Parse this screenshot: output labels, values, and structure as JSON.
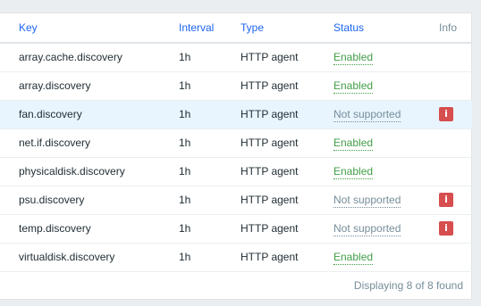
{
  "table": {
    "columns": [
      "Key",
      "Interval",
      "Type",
      "Status",
      "Info"
    ],
    "rows": [
      {
        "key": "array.cache.discovery",
        "interval": "1h",
        "type": "HTTP agent",
        "status": "Enabled",
        "info": false
      },
      {
        "key": "array.discovery",
        "interval": "1h",
        "type": "HTTP agent",
        "status": "Enabled",
        "info": false
      },
      {
        "key": "fan.discovery",
        "interval": "1h",
        "type": "HTTP agent",
        "status": "Not supported",
        "info": true,
        "highlighted": true
      },
      {
        "key": "net.if.discovery",
        "interval": "1h",
        "type": "HTTP agent",
        "status": "Enabled",
        "info": false
      },
      {
        "key": "physicaldisk.discovery",
        "interval": "1h",
        "type": "HTTP agent",
        "status": "Enabled",
        "info": false
      },
      {
        "key": "psu.discovery",
        "interval": "1h",
        "type": "HTTP agent",
        "status": "Not supported",
        "info": true
      },
      {
        "key": "temp.discovery",
        "interval": "1h",
        "type": "HTTP agent",
        "status": "Not supported",
        "info": true
      },
      {
        "key": "virtualdisk.discovery",
        "interval": "1h",
        "type": "HTTP agent",
        "status": "Enabled",
        "info": false
      }
    ],
    "info_icon_glyph": "i"
  },
  "footer": {
    "text": "Displaying 8 of 8 found"
  },
  "colors": {
    "link": "#1f65f4",
    "enabled": "#429e47",
    "not_supported": "#768d99",
    "info_icon": "#d64e4e",
    "highlight_row": "#e8f5ff"
  },
  "icons": {
    "info": "info-error-icon"
  }
}
